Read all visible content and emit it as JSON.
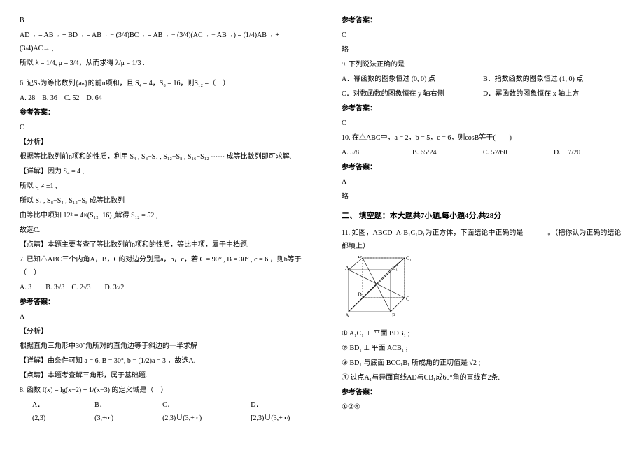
{
  "left": {
    "q5_answer": "B",
    "q5_expr1": "AD→ = AB→ + BD→ = AB→ − (3/4)BC→ = AB→ − (3/4)(AC→ − AB→) = (1/4)AB→ + (3/4)AC→ ,",
    "q5_expr2": "所以 λ = 1/4, μ = 3/4，从而求得 λ/μ = 1/3 .",
    "q6_stem": "6. 记Sₙ为等比数列{aₙ}的前n项和，且 S₄ = 4，S₈ = 16，则S₁₂ =（　）",
    "q6_choices": "A. 28　B. 36　C. 52　D. 64",
    "q6_ans_title": "参考答案：",
    "q6_ans": "C",
    "q6_fenxi": "【分析】",
    "q6_fenxi_body": "根据等比数列前n项和的性质，利用 S₄ , S₈−S₄ , S₁₂−S₈ , S₁₆−S₁₂ ⋯⋯ 成等比数列即可求解.",
    "q6_xiangjie": "【详解】因为 S₄ = 4 ,",
    "q6_line_a": "所以 q ≠ ±1 ,",
    "q6_line_b": "所以 S₄ , S₈−S₄ , S₁₂−S₈ 成等比数列",
    "q6_line_c": "由等比中项知 12² = 4×(S₁₂−16) ,解得 S₁₂ = 52 ,",
    "q6_line_d": "故选C.",
    "q6_dianjing": "【点睛】本题主要考查了等比数列前n项和的性质，等比中项，属于中档题.",
    "q7_stem": "7. 已知△ABC三个内角A，B，C的对边分别是a，b，c，若 C = 90° , B = 30° , c = 6 ，则b等于（　）",
    "q7_choices": "A. 3　　B. 3√3　C. 2√3　　D. 3√2",
    "q7_ans_title": "参考答案：",
    "q7_ans": "A",
    "q7_fenxi": "【分析】",
    "q7_fenxi_body": "根据直角三角形中30°角所对的直角边等于斜边的一半求解",
    "q7_xiangjie": "【详解】由条件可知 a = 6, B = 30°, b = (1/2)a = 3 ，故选A.",
    "q7_dianjing": "【点睛】本题考查解三角形，属于基础题.",
    "q8_stem": "8. 函数 f(x) = lg(x−2) + 1/(x−3) 的定义域是（　）",
    "q8_choices": {
      "a": "A．(2,3)",
      "b": "B．(3,+∞)",
      "c": "C．(2,3)∪(3,+∞)",
      "d": "D．[2,3)∪(3,+∞)"
    }
  },
  "right": {
    "q8_ans_title": "参考答案：",
    "q8_ans": "C",
    "q8_note": "略",
    "q9_stem": "9. 下列说法正确的是",
    "q9_a": "A．幂函数的图象恒过 (0, 0) 点",
    "q9_b": "B．指数函数的图象恒过 (1, 0) 点",
    "q9_c": "C．对数函数的图象恒在 y 轴右侧",
    "q9_d": "D．幂函数的图象恒在 x 轴上方",
    "q9_ans_title": "参考答案：",
    "q9_ans": "C",
    "q10_stem": "10. 在△ABC中，a = 2，b = 5，c = 6，则cosB等于(　　)",
    "q10_a": "A. 5/8",
    "q10_b": "B. 65/24",
    "q10_c": "C. 57/60",
    "q10_d": "D. − 7/20",
    "q10_ans_title": "参考答案：",
    "q10_ans": "A",
    "q10_note": "略",
    "section2": "二、 填空题：本大题共7小题,每小题4分,共28分",
    "q11_stem": "11. 如图，ABCD- A₁B₁C₁D₁为正方体，下面结论中正确的是_______。（把你认为正确的结论都填上）",
    "q11_1": "① A₁C₁ ⊥ 平面 BDB₁ ;",
    "q11_2": "② BD₁ ⊥ 平面 ACB₁ ;",
    "q11_3": "③ BD₁ 与底面 BCC₁B₁ 所成角的正切值是 √2 ;",
    "q11_4": "④ 过点A₁与异面直线AD与CB₁成60°角的直线有2条.",
    "q11_ans_title": "参考答案：",
    "q11_ans": "①②④"
  }
}
